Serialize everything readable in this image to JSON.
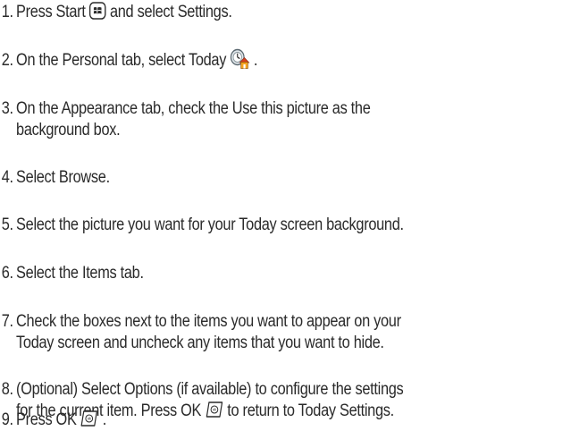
{
  "steps": [
    {
      "number": "1.",
      "before_icon": "Press Start",
      "icon": "windows-start-icon",
      "after_icon": "and select Settings."
    },
    {
      "number": "2.",
      "before_icon": "On the Personal tab, select Today",
      "icon": "today-settings-icon",
      "after_icon": "."
    },
    {
      "number": "3.",
      "line1": "On the Appearance tab, check the Use this picture as the",
      "line2": "background box."
    },
    {
      "number": "4.",
      "line1": "Select Browse."
    },
    {
      "number": "5.",
      "line1": "Select the picture you want for your Today screen background."
    },
    {
      "number": "6.",
      "line1": "Select the Items tab."
    },
    {
      "number": "7.",
      "line1": "Check the boxes next to the items you want to appear on your",
      "line2": "Today screen and uncheck any items that you want to hide."
    },
    {
      "number": "8.",
      "line1": "(Optional) Select Options (if available) to configure the settings",
      "line2_before_icon": "for the current item. Press OK",
      "icon": "ok-key-icon",
      "line2_after_icon": "to return to Today Settings."
    },
    {
      "number": "9.",
      "before_icon": "Press OK",
      "icon": "ok-key-icon",
      "after_icon": "."
    }
  ]
}
